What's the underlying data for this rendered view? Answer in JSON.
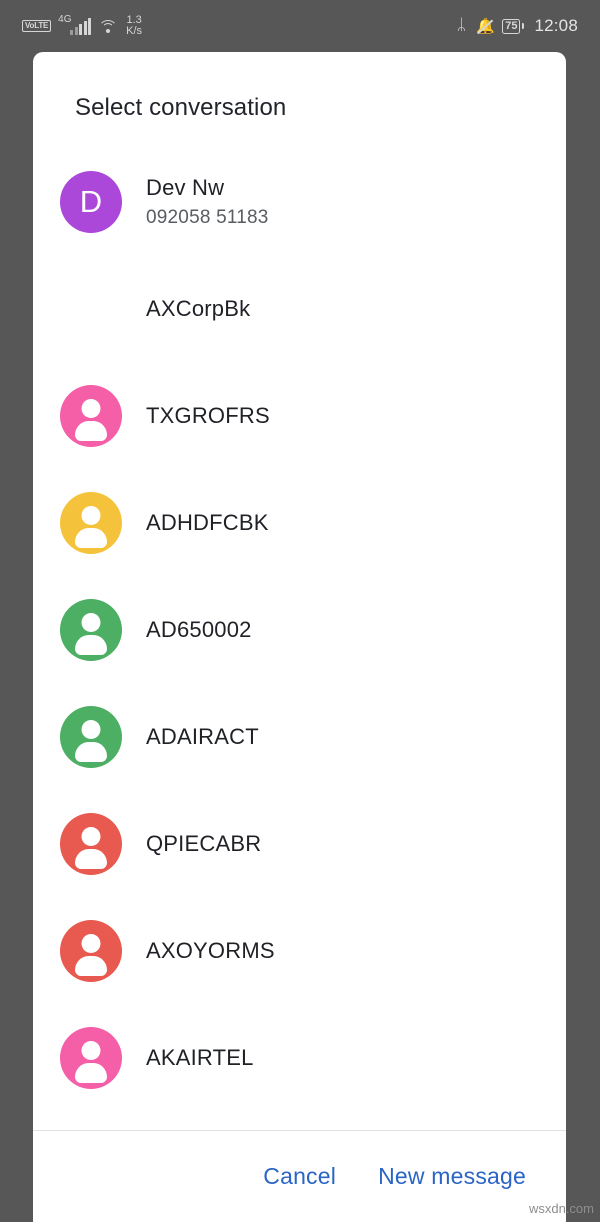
{
  "status_bar": {
    "volte_label": "VoLTE",
    "network_type": "4G",
    "signal_icon": "signal-bars-icon",
    "wifi_icon": "wifi-icon",
    "data_speed_value": "1.3",
    "data_speed_unit": "K/s",
    "bluetooth_icon": "bluetooth-icon",
    "silent_icon": "bell-muted-icon",
    "battery_level": "75",
    "time": "12:08"
  },
  "dialog": {
    "title": "Select conversation",
    "conversations": [
      {
        "name": "Dev Nw",
        "subtitle": "092058 51183",
        "avatar_type": "initial",
        "initial": "D",
        "color": "#ab47d9"
      },
      {
        "name": "AXCorpBk",
        "subtitle": "",
        "avatar_type": "person",
        "initial": "",
        "color": "#a martin"
      },
      {
        "name": "TXGROFRS",
        "subtitle": "",
        "avatar_type": "person",
        "initial": "",
        "color": "#f45fa8"
      },
      {
        "name": "ADHDFCBK",
        "subtitle": "",
        "avatar_type": "person",
        "initial": "",
        "color": "#f5c33b"
      },
      {
        "name": "AD650002",
        "subtitle": "",
        "avatar_type": "person",
        "initial": "",
        "color": "#4caf64"
      },
      {
        "name": "ADAIRACT",
        "subtitle": "",
        "avatar_type": "person",
        "initial": "",
        "color": "#4caf64"
      },
      {
        "name": "QPIECABR",
        "subtitle": "",
        "avatar_type": "person",
        "initial": "",
        "color": "#e8594f"
      },
      {
        "name": "AXOYORMS",
        "subtitle": "",
        "avatar_type": "person",
        "initial": "",
        "color": "#e8594f"
      },
      {
        "name": "AKAIRTEL",
        "subtitle": "",
        "avatar_type": "person",
        "initial": "",
        "color": "#f45fa8"
      },
      {
        "name": "",
        "subtitle": "",
        "avatar_type": "person",
        "initial": "",
        "color": "#f08b33"
      }
    ],
    "footer": {
      "cancel_label": "Cancel",
      "new_message_label": "New message"
    }
  },
  "watermark": "wsxdn.com",
  "colors": {
    "screen_background": "#575757",
    "dialog_background": "#ffffff",
    "action_blue": "#2a65c4",
    "title_text": "#21242b",
    "subtitle_text": "#585c63"
  }
}
